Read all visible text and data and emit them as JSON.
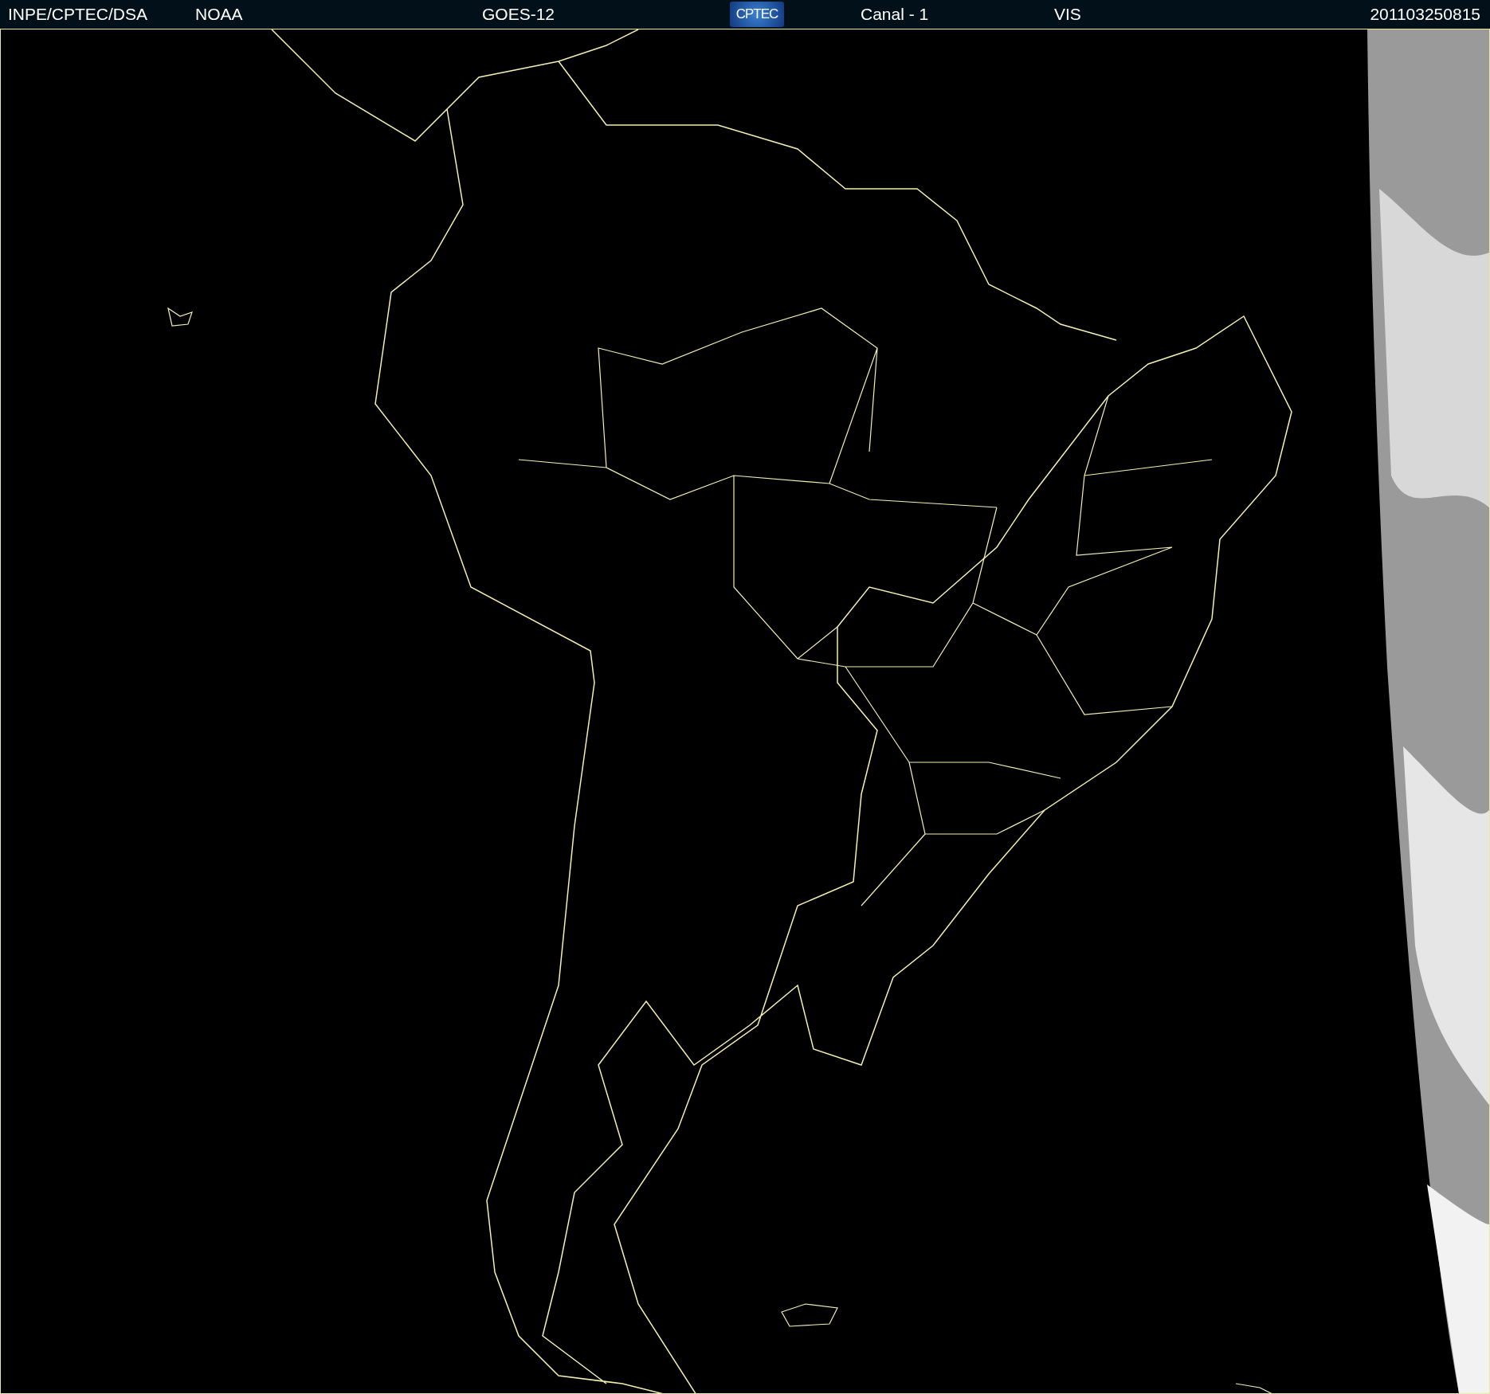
{
  "header": {
    "source": "INPE/CPTEC/DSA",
    "agency": "NOAA",
    "satellite": "GOES-12",
    "logo": "CPTEC",
    "channel": "Canal - 1",
    "band": "VIS",
    "timestamp": "201103250815"
  }
}
